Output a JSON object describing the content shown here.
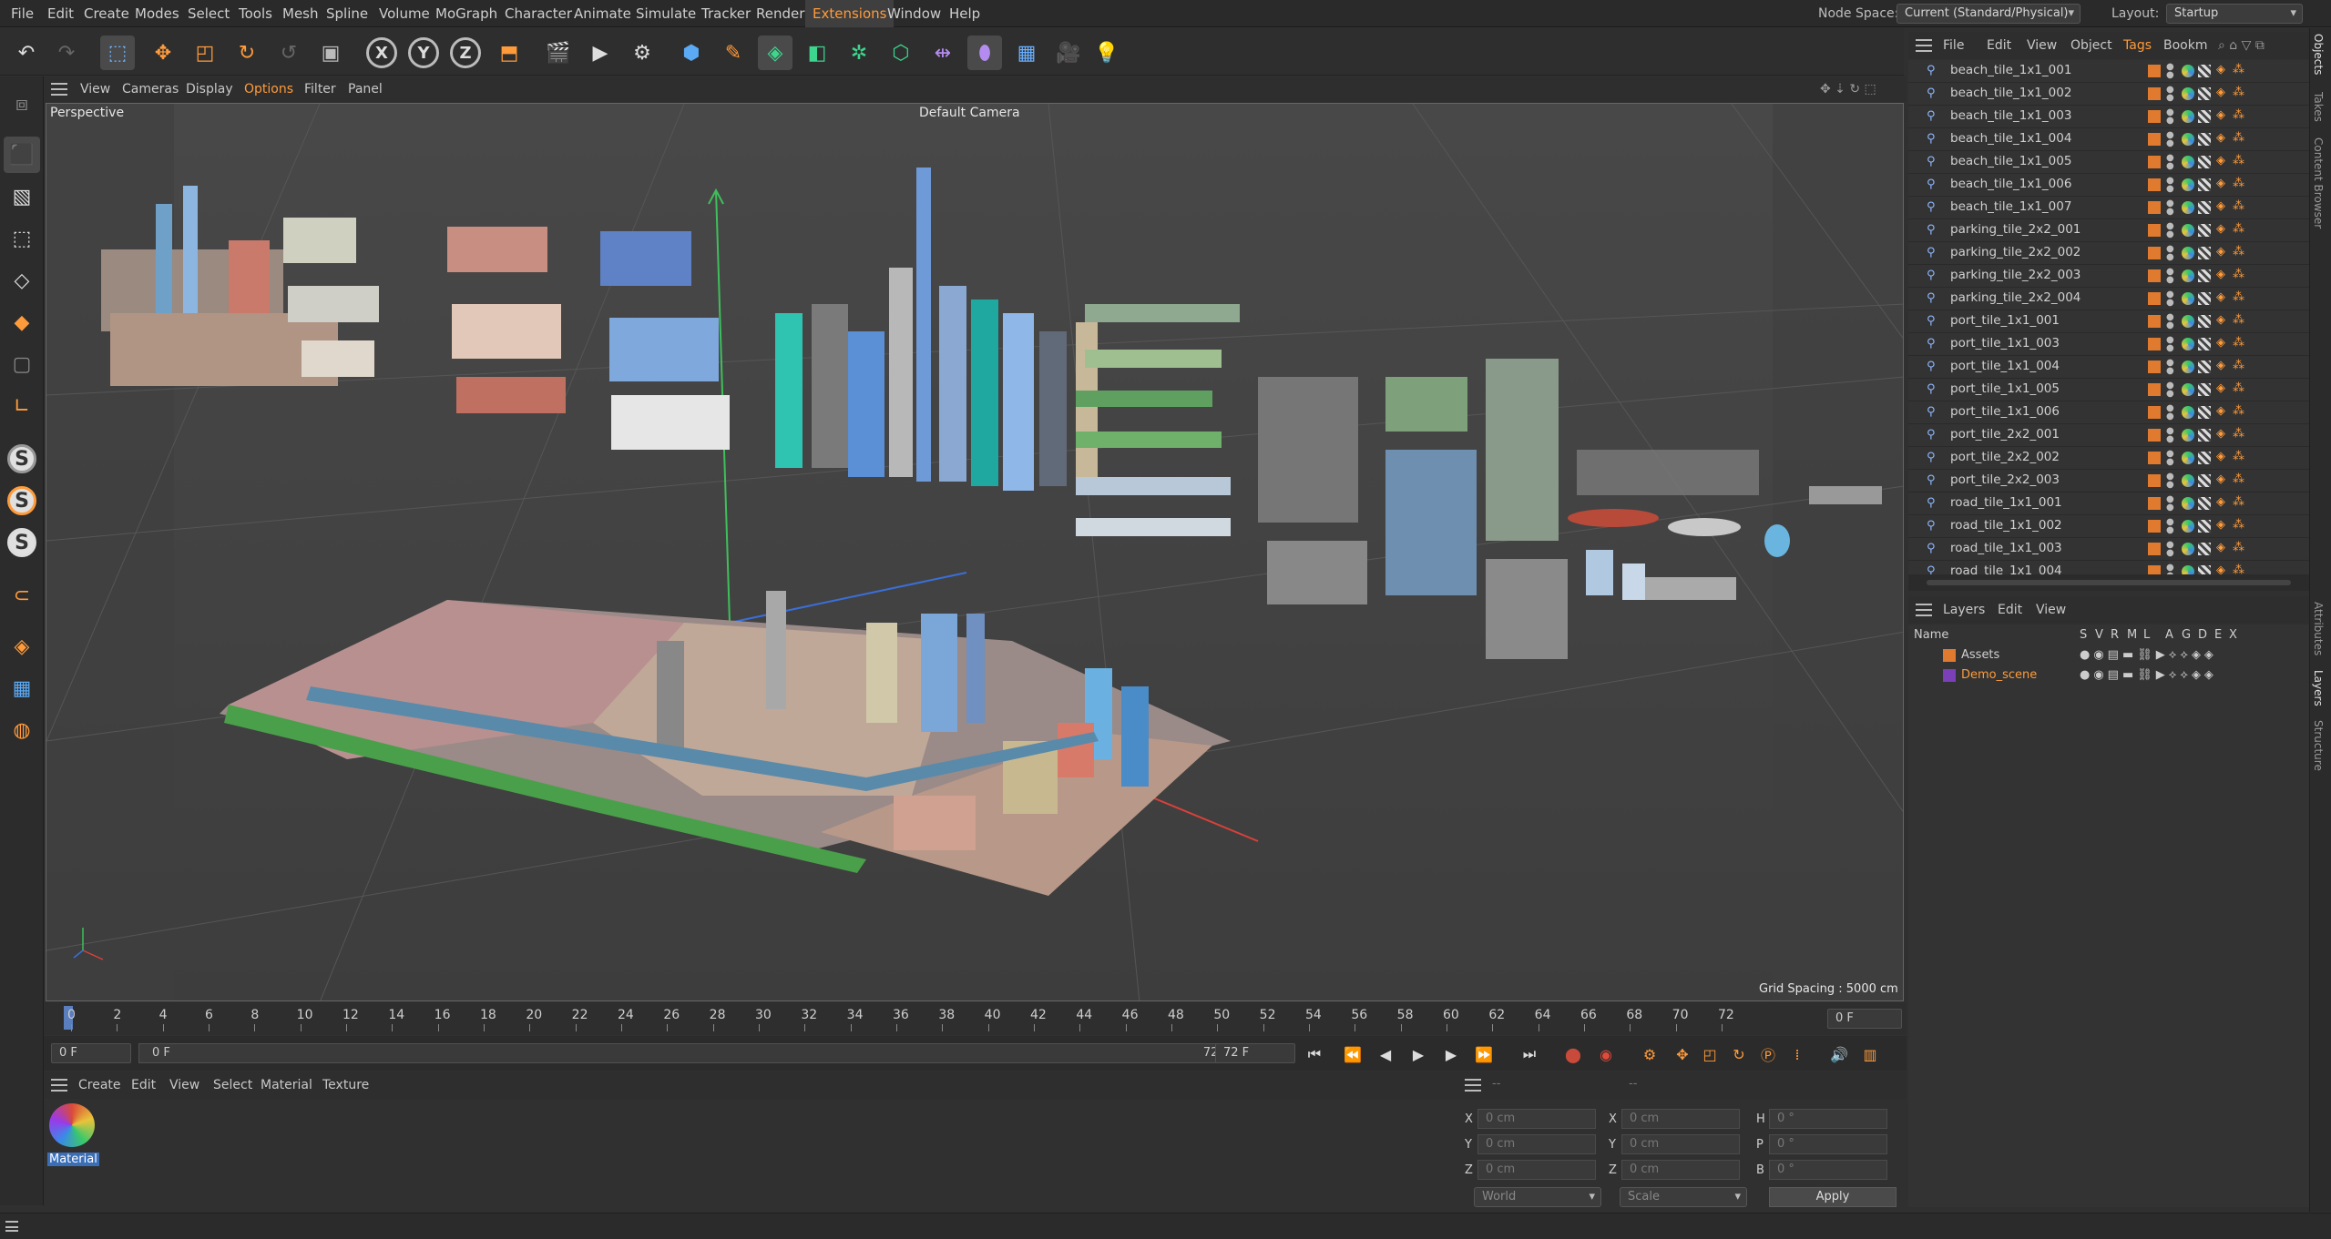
{
  "menubar": {
    "items": [
      "File",
      "Edit",
      "Create",
      "Modes",
      "Select",
      "Tools",
      "Mesh",
      "Spline",
      "Volume",
      "MoGraph",
      "Character",
      "Animate",
      "Simulate",
      "Tracker",
      "Render",
      "Extensions",
      "Window",
      "Help"
    ],
    "active_item": "Extensions",
    "node_space_label": "Node Space:",
    "node_space_value": "Current (Standard/Physical)",
    "layout_label": "Layout:",
    "layout_value": "Startup"
  },
  "toolbar": {
    "icons": [
      "undo-icon",
      "redo-icon",
      "live-selection-icon",
      "move-icon",
      "scale-icon",
      "rotate-icon",
      "recent-tool-icon",
      "selection-tool-icon",
      "x-axis-icon",
      "y-axis-icon",
      "z-axis-icon",
      "coordinate-system-icon",
      "render-view-icon",
      "render-to-picture-viewer-icon",
      "render-settings-icon",
      "cube-icon",
      "pen-icon",
      "subdivision-icon",
      "extrude-icon",
      "cloner-icon",
      "mograph-icon",
      "symmetry-icon",
      "deformer-icon",
      "floor-icon",
      "camera-icon",
      "light-icon"
    ],
    "axis_labels": [
      "X",
      "Y",
      "Z"
    ]
  },
  "viewport": {
    "menu": [
      "View",
      "Cameras",
      "Display",
      "Options",
      "Filter",
      "Panel"
    ],
    "active_menu": "Options",
    "projection": "Perspective",
    "camera": "Default Camera",
    "grid_spacing": "Grid Spacing : 5000 cm"
  },
  "timeline": {
    "ticks": [
      "0",
      "2",
      "4",
      "6",
      "8",
      "10",
      "12",
      "14",
      "16",
      "18",
      "20",
      "22",
      "24",
      "26",
      "28",
      "30",
      "32",
      "34",
      "36",
      "38",
      "40",
      "42",
      "44",
      "46",
      "48",
      "50",
      "52",
      "54",
      "56",
      "58",
      "60",
      "62",
      "64",
      "66",
      "68",
      "70",
      "72"
    ],
    "current_frame": "0 F",
    "start_frame": "0 F",
    "range_start": "0 F",
    "range_end": "72 F",
    "end_frame": "72 F"
  },
  "material_manager": {
    "menu": [
      "Create",
      "Edit",
      "View",
      "Select",
      "Material",
      "Texture"
    ],
    "material_name": "Material"
  },
  "coordinates": {
    "rows": [
      {
        "l1": "X",
        "v1": "0 cm",
        "l2": "X",
        "v2": "0 cm",
        "l3": "H",
        "v3": "0 °"
      },
      {
        "l1": "Y",
        "v1": "0 cm",
        "l2": "Y",
        "v2": "0 cm",
        "l3": "P",
        "v3": "0 °"
      },
      {
        "l1": "Z",
        "v1": "0 cm",
        "l2": "Z",
        "v2": "0 cm",
        "l3": "B",
        "v3": "0 °"
      }
    ],
    "space": "World",
    "mode": "Scale",
    "apply_label": "Apply",
    "dashes": [
      "--",
      "--"
    ]
  },
  "object_manager": {
    "menu": [
      "File",
      "Edit",
      "View",
      "Object",
      "Tags",
      "Bookm"
    ],
    "active_menu": "Tags",
    "objects": [
      "beach_tile_1x1_001",
      "beach_tile_1x1_002",
      "beach_tile_1x1_003",
      "beach_tile_1x1_004",
      "beach_tile_1x1_005",
      "beach_tile_1x1_006",
      "beach_tile_1x1_007",
      "parking_tile_2x2_001",
      "parking_tile_2x2_002",
      "parking_tile_2x2_003",
      "parking_tile_2x2_004",
      "port_tile_1x1_001",
      "port_tile_1x1_003",
      "port_tile_1x1_004",
      "port_tile_1x1_005",
      "port_tile_1x1_006",
      "port_tile_2x2_001",
      "port_tile_2x2_002",
      "port_tile_2x2_003",
      "road_tile_1x1_001",
      "road_tile_1x1_002",
      "road_tile_1x1_003",
      "road_tile_1x1_004"
    ]
  },
  "layers": {
    "menu": [
      "Layers",
      "Edit",
      "View"
    ],
    "name_header": "Name",
    "columns": [
      "S",
      "V",
      "R",
      "M",
      "L",
      "A",
      "G",
      "D",
      "E",
      "X"
    ],
    "items": [
      {
        "name": "Assets",
        "color": "#e07a2e"
      },
      {
        "name": "Demo_scene",
        "color": "#7b3fb8"
      }
    ]
  },
  "right_tabs": [
    "Objects",
    "Takes",
    "Content Browser",
    "Attributes",
    "Layers",
    "Structure"
  ],
  "colors": {
    "accent": "#ff9b3a",
    "layer_assets": "#e07a2e",
    "layer_demo": "#7b3fb8"
  }
}
